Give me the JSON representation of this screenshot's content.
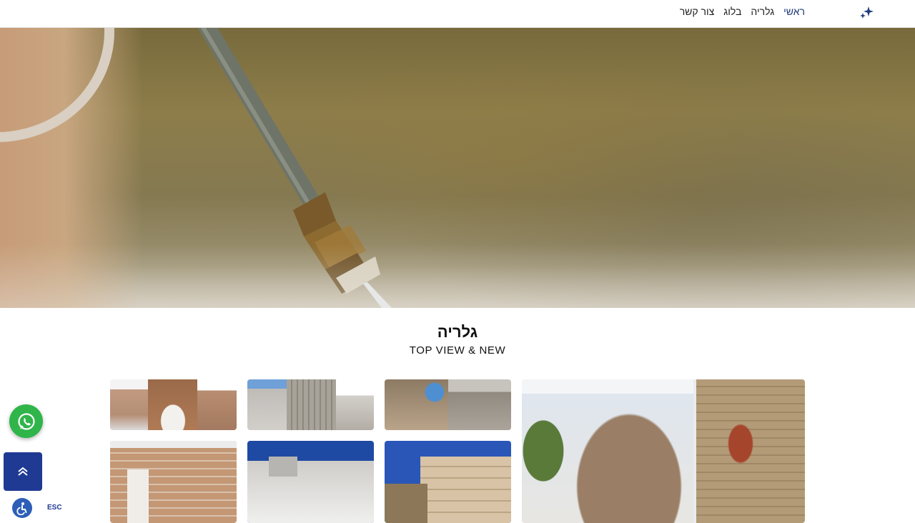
{
  "header": {
    "logo_icon": "sparkle-icon",
    "nav": [
      {
        "label": "ראשי",
        "active": true
      },
      {
        "label": "גלריה",
        "active": false
      },
      {
        "label": "בלוג",
        "active": false
      },
      {
        "label": "צור קשר",
        "active": false
      }
    ]
  },
  "hero": {
    "image": "pressure-washer-lance-cleaning-roof"
  },
  "gallery": {
    "title": "גלריה",
    "subtitle": "TOP VIEW & NEW",
    "thumbnails": [
      "arches-renovation-collage",
      "roof-waterproofing-collage",
      "roof-worker-collage",
      "stone-facade-before-after",
      "brick-wall-interior",
      "white-roof-coating",
      "building-facade-work"
    ]
  },
  "widgets": {
    "whatsapp_icon": "whatsapp-icon",
    "scroll_top_icon": "chevron-up-icon",
    "accessibility_icon": "accessibility-icon",
    "accessibility_label": "ESC"
  },
  "colors": {
    "accent": "#1e3a7a",
    "whatsapp": "#2fb54a",
    "scroll_top": "#1f3a93"
  }
}
